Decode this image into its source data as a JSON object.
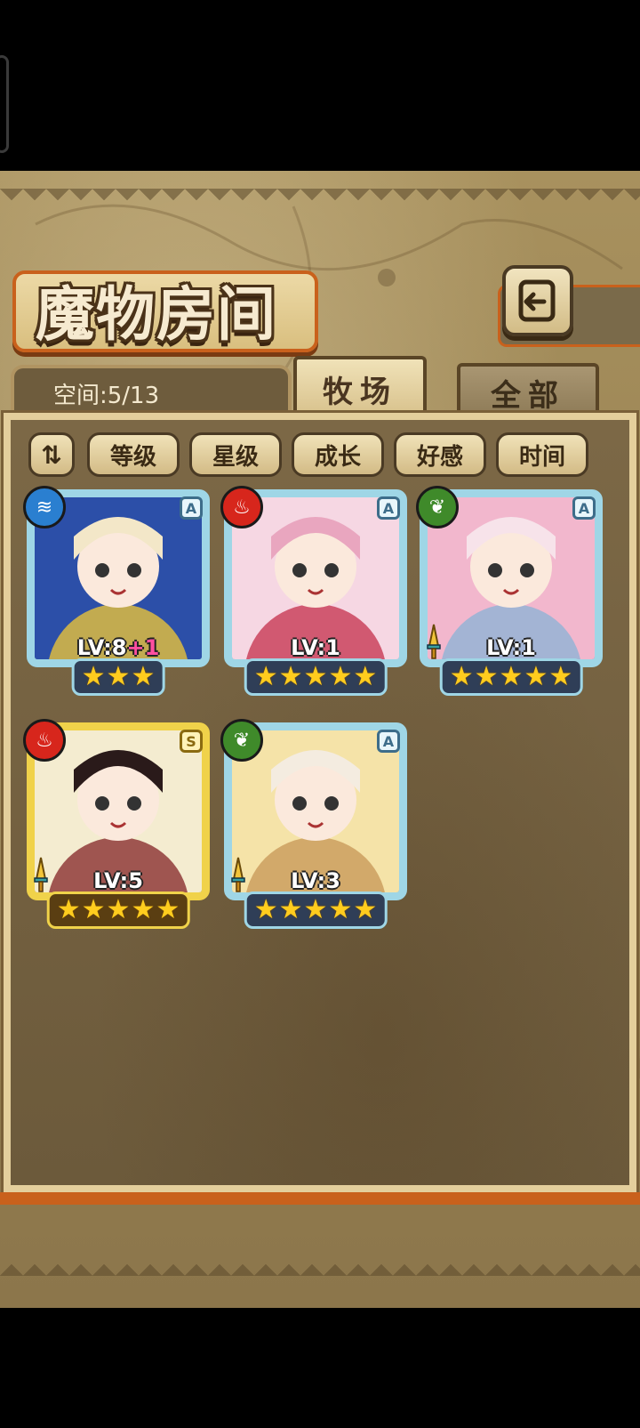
{
  "header": {
    "title": "魔物房间",
    "back_icon": "back-arrow-icon"
  },
  "space": {
    "label": "空间:5/13"
  },
  "tabs": [
    {
      "label": "牧场",
      "active": true
    },
    {
      "label": "全部",
      "active": false
    }
  ],
  "sort": {
    "toggle_label": "⇅",
    "buttons": [
      "等级",
      "星级",
      "成长",
      "好感",
      "时间"
    ]
  },
  "monsters": [
    {
      "element": "water",
      "element_icon": "water-element-icon",
      "rank": "A",
      "level": "LV:8",
      "level_bonus": "+1",
      "stars": 3,
      "frame": "blue",
      "weapon": false
    },
    {
      "element": "fire",
      "element_icon": "fire-element-icon",
      "rank": "A",
      "level": "LV:1",
      "level_bonus": "",
      "stars": 5,
      "frame": "blue",
      "weapon": false
    },
    {
      "element": "wood",
      "element_icon": "leaf-element-icon",
      "rank": "A",
      "level": "LV:1",
      "level_bonus": "",
      "stars": 5,
      "frame": "blue",
      "weapon": true
    },
    {
      "element": "fire",
      "element_icon": "fire-element-icon",
      "rank": "S",
      "level": "LV:5",
      "level_bonus": "",
      "stars": 5,
      "frame": "gold",
      "weapon": true
    },
    {
      "element": "wood",
      "element_icon": "leaf-element-icon",
      "rank": "A",
      "level": "LV:3",
      "level_bonus": "",
      "stars": 5,
      "frame": "blue",
      "weapon": true
    }
  ],
  "colors": {
    "water": "#2a7fd0",
    "fire": "#d7261c",
    "wood": "#3f8a2a",
    "accent_orange": "#c9611c",
    "star": "#ffcc1e"
  }
}
